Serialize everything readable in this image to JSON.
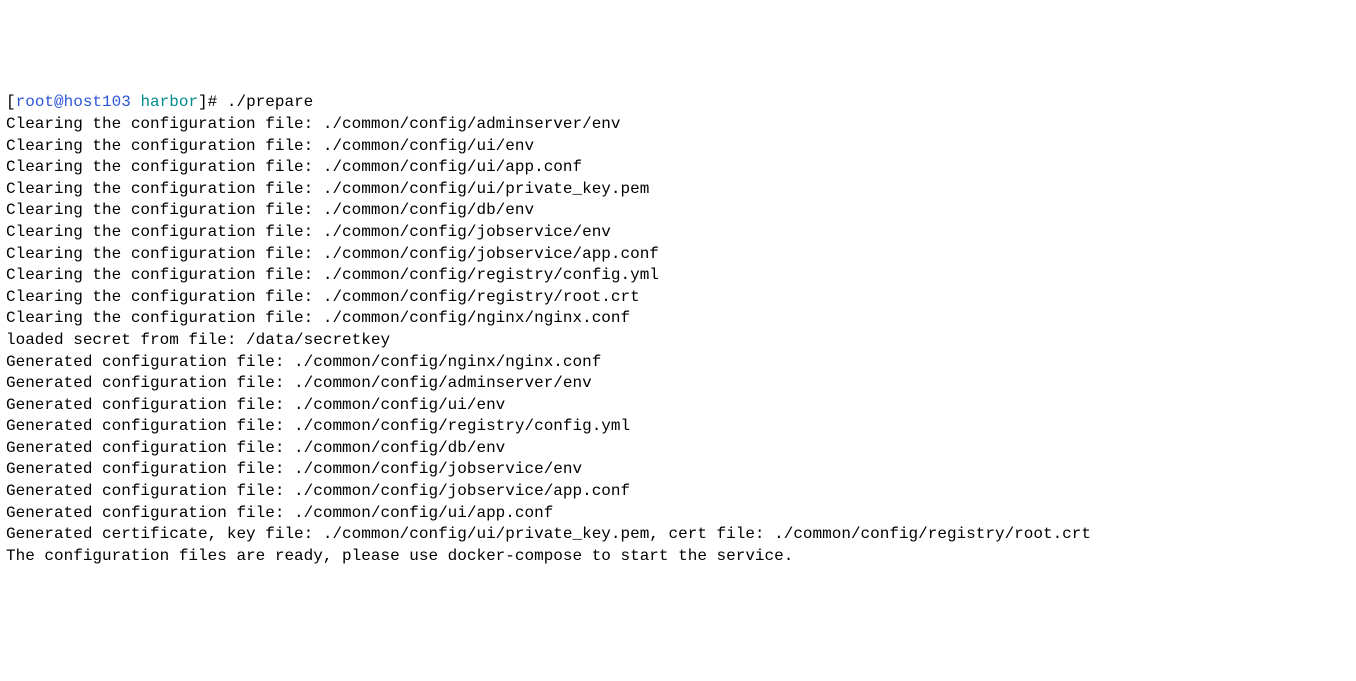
{
  "prompt": {
    "open": "[",
    "user": "root@host103",
    "space": " ",
    "path": "harbor",
    "close": "]# ",
    "command": "./prepare"
  },
  "lines": [
    "Clearing the configuration file: ./common/config/adminserver/env",
    "Clearing the configuration file: ./common/config/ui/env",
    "Clearing the configuration file: ./common/config/ui/app.conf",
    "Clearing the configuration file: ./common/config/ui/private_key.pem",
    "Clearing the configuration file: ./common/config/db/env",
    "Clearing the configuration file: ./common/config/jobservice/env",
    "Clearing the configuration file: ./common/config/jobservice/app.conf",
    "Clearing the configuration file: ./common/config/registry/config.yml",
    "Clearing the configuration file: ./common/config/registry/root.crt",
    "Clearing the configuration file: ./common/config/nginx/nginx.conf",
    "loaded secret from file: /data/secretkey",
    "Generated configuration file: ./common/config/nginx/nginx.conf",
    "Generated configuration file: ./common/config/adminserver/env",
    "Generated configuration file: ./common/config/ui/env",
    "Generated configuration file: ./common/config/registry/config.yml",
    "Generated configuration file: ./common/config/db/env",
    "Generated configuration file: ./common/config/jobservice/env",
    "Generated configuration file: ./common/config/jobservice/app.conf",
    "Generated configuration file: ./common/config/ui/app.conf",
    "Generated certificate, key file: ./common/config/ui/private_key.pem, cert file: ./common/config/registry/root.crt",
    "The configuration files are ready, please use docker-compose to start the service."
  ]
}
